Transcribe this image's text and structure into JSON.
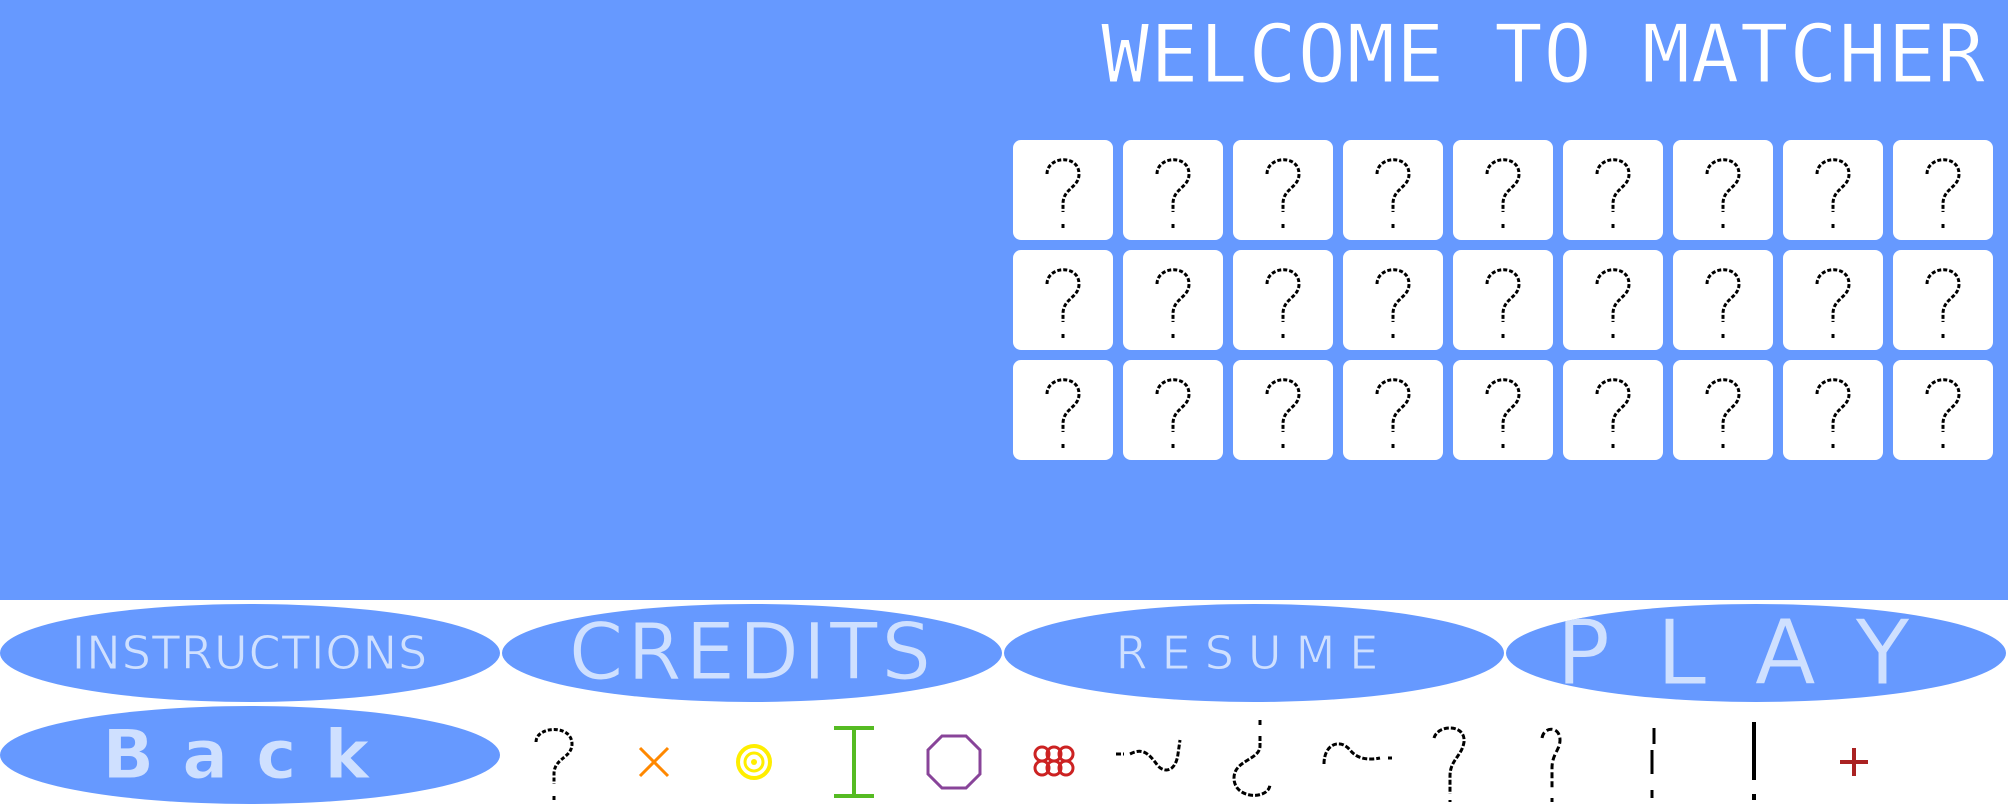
{
  "title": "WELCOME TO MATCHER",
  "board": {
    "rows": 3,
    "cols": 9,
    "card_face": "?",
    "card_color": "#ffffff",
    "background_color": "#6699ff"
  },
  "menu": {
    "instructions": "INSTRUCTIONS",
    "credits": "CREDITS",
    "resume": "RESUME",
    "play": "PLAY",
    "back": "Back"
  },
  "symbols": [
    {
      "name": "question-mark-icon",
      "color": "#000000"
    },
    {
      "name": "cross-icon",
      "color": "#ff8800"
    },
    {
      "name": "spiral-icon",
      "color": "#ffee00"
    },
    {
      "name": "i-beam-icon",
      "color": "#55bb22"
    },
    {
      "name": "octagon-icon",
      "color": "#884499"
    },
    {
      "name": "knot-icon",
      "color": "#cc2222"
    },
    {
      "name": "squiggle-icon",
      "color": "#000000"
    },
    {
      "name": "inverted-question-icon",
      "color": "#000000"
    },
    {
      "name": "tilde-curl-icon",
      "color": "#000000"
    },
    {
      "name": "question-variant-a-icon",
      "color": "#000000"
    },
    {
      "name": "question-variant-b-icon",
      "color": "#000000"
    },
    {
      "name": "broken-exclamation-icon",
      "color": "#000000"
    },
    {
      "name": "exclamation-icon",
      "color": "#000000"
    },
    {
      "name": "plus-icon",
      "color": "#aa2222"
    }
  ]
}
